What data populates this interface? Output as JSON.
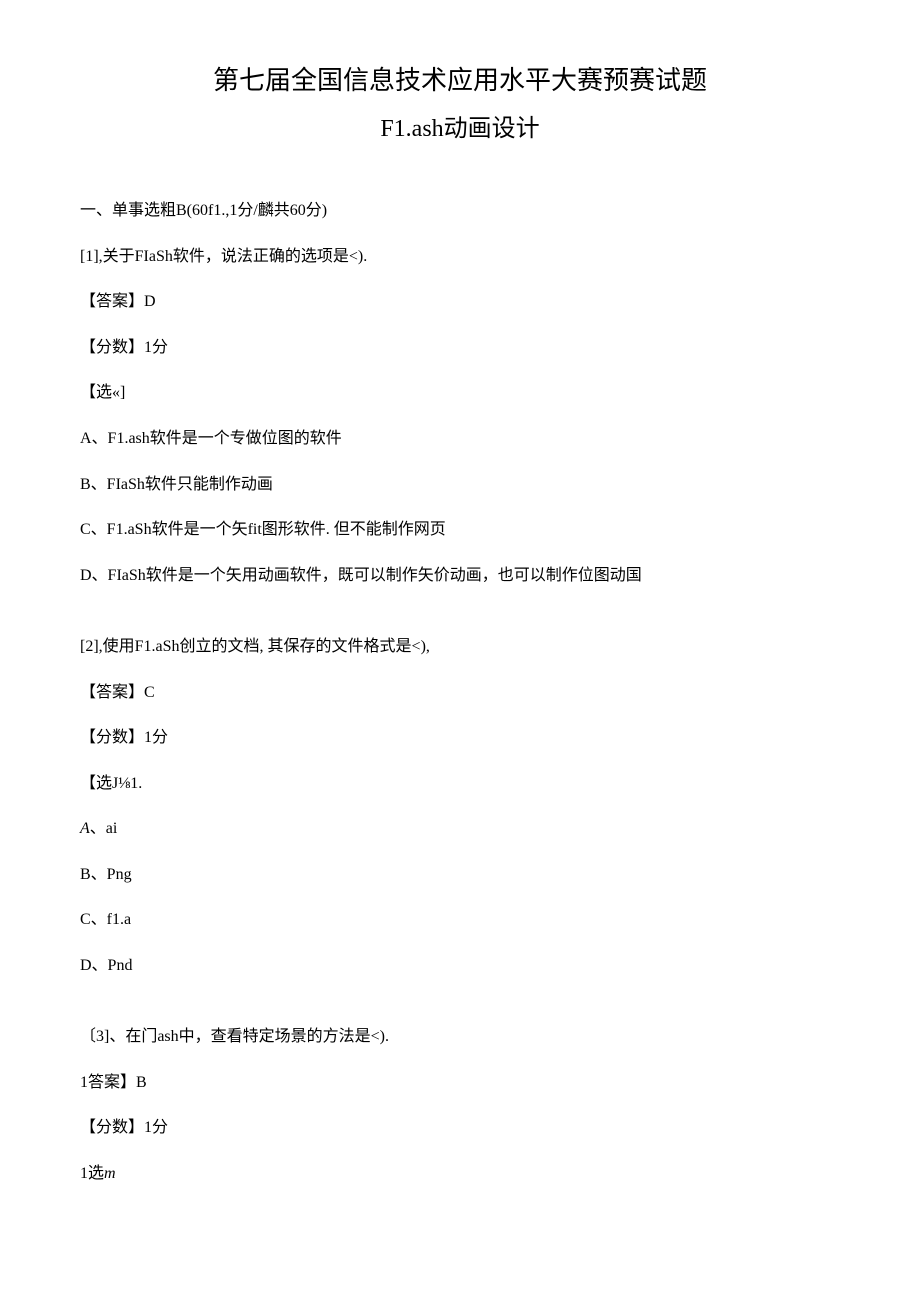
{
  "title": "第七届全国信息技术应用水平大赛预赛试题",
  "subtitle": "F1.ash动画设计",
  "section_header": "一、单事选粗B(60f1.,1分/麟共60分)",
  "q1": {
    "prompt": "[1],关于FIaSh软件，说法正确的选项是<).",
    "answer": "【答案】D",
    "score": "【分数】1分",
    "opts_label": "【选«]",
    "opt_a": "A、F1.ash软件是一个专做位图的软件",
    "opt_b": "B、FIaSh软件只能制作动画",
    "opt_c": "C、F1.aSh软件是一个矢fit图形软件. 但不能制作网页",
    "opt_d": "D、FIaSh软件是一个矢用动画软件，既可以制作矢价动画，也可以制作位图动国"
  },
  "q2": {
    "prompt": "[2],使用F1.aSh创立的文档, 其保存的文件格式是<),",
    "answer": "【答案】C",
    "score": "【分数】1分",
    "opts_label": "【选J⅛1.",
    "opt_a_prefix": "A",
    "opt_a_suffix": "、ai",
    "opt_b": "B、Png",
    "opt_c": "C、f1.a",
    "opt_d": "D、Pnd"
  },
  "q3": {
    "prompt": "〔3]、在门ash中，查看特定场景的方法是<).",
    "answer": "1答案】B",
    "score": "【分数】1分",
    "opts_label_prefix": "1选",
    "opts_label_suffix": "m"
  }
}
